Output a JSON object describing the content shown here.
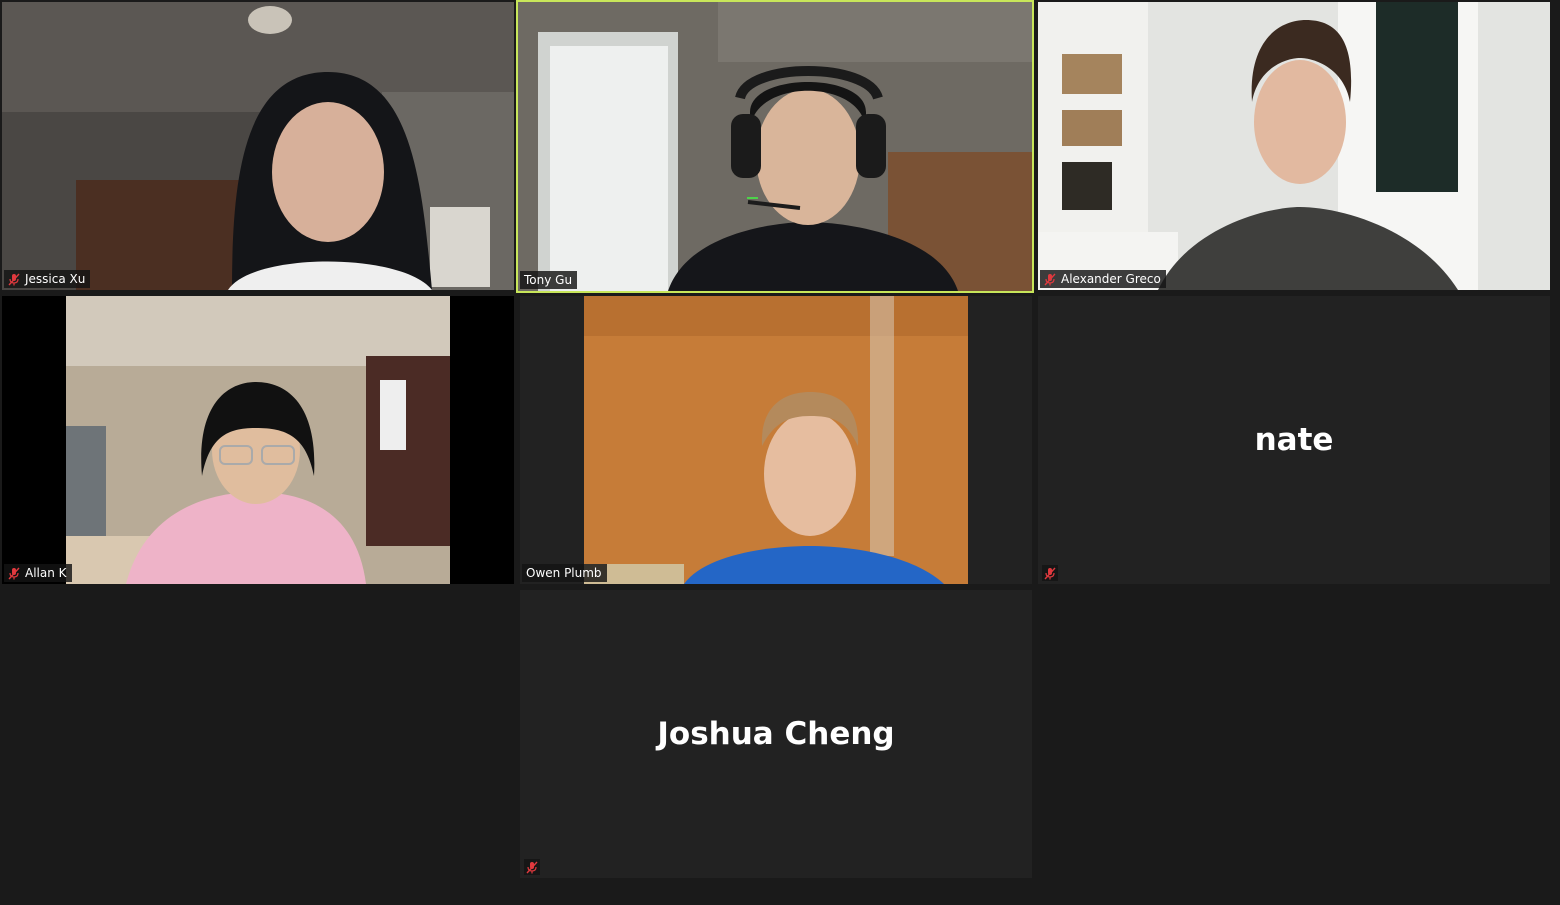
{
  "participants": {
    "jessica": {
      "name": "Jessica Xu",
      "muted": true,
      "video": true
    },
    "tony": {
      "name": "Tony Gu",
      "muted": false,
      "video": true,
      "active_speaker": true
    },
    "alexander": {
      "name": "Alexander Greco",
      "muted": true,
      "video": true
    },
    "allan": {
      "name": "Allan K",
      "muted": true,
      "video": true
    },
    "owen": {
      "name": "Owen Plumb",
      "muted": false,
      "video": true
    },
    "nate": {
      "name": "nate",
      "muted": true,
      "video": false
    },
    "joshua": {
      "name": "Joshua Cheng",
      "muted": true,
      "video": false
    }
  },
  "icons": {
    "mute": "microphone-muted-icon"
  },
  "colors": {
    "active_speaker_border": "#c8e65a",
    "mute_red": "#e0393e",
    "tile_bg": "#222222",
    "gallery_bg": "#1a1a1a"
  }
}
